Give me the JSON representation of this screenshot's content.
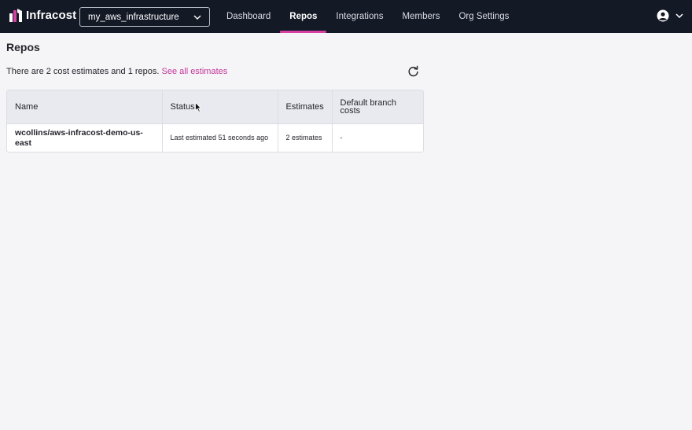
{
  "app": {
    "brand": "Infracost",
    "org_selector": "my_aws_infrastructure",
    "nav": [
      {
        "label": "Dashboard",
        "active": false
      },
      {
        "label": "Repos",
        "active": true
      },
      {
        "label": "Integrations",
        "active": false
      },
      {
        "label": "Members",
        "active": false
      },
      {
        "label": "Org Settings",
        "active": false
      }
    ],
    "accent_color": "#d63fa4",
    "nav_background": "#141926"
  },
  "page": {
    "title": "Repos",
    "summary_text": "There are 2 cost estimates and 1 repos.",
    "summary_link": "See all estimates",
    "refresh_icon": "refresh-icon"
  },
  "table": {
    "headers": [
      "Name",
      "Status",
      "Estimates",
      "Default branch costs"
    ],
    "rows": [
      {
        "name": "wcollins/aws-infracost-demo-us-east",
        "status": "Last estimated 51 seconds ago",
        "estimates": "2 estimates",
        "default_branch_costs": "-"
      }
    ]
  }
}
